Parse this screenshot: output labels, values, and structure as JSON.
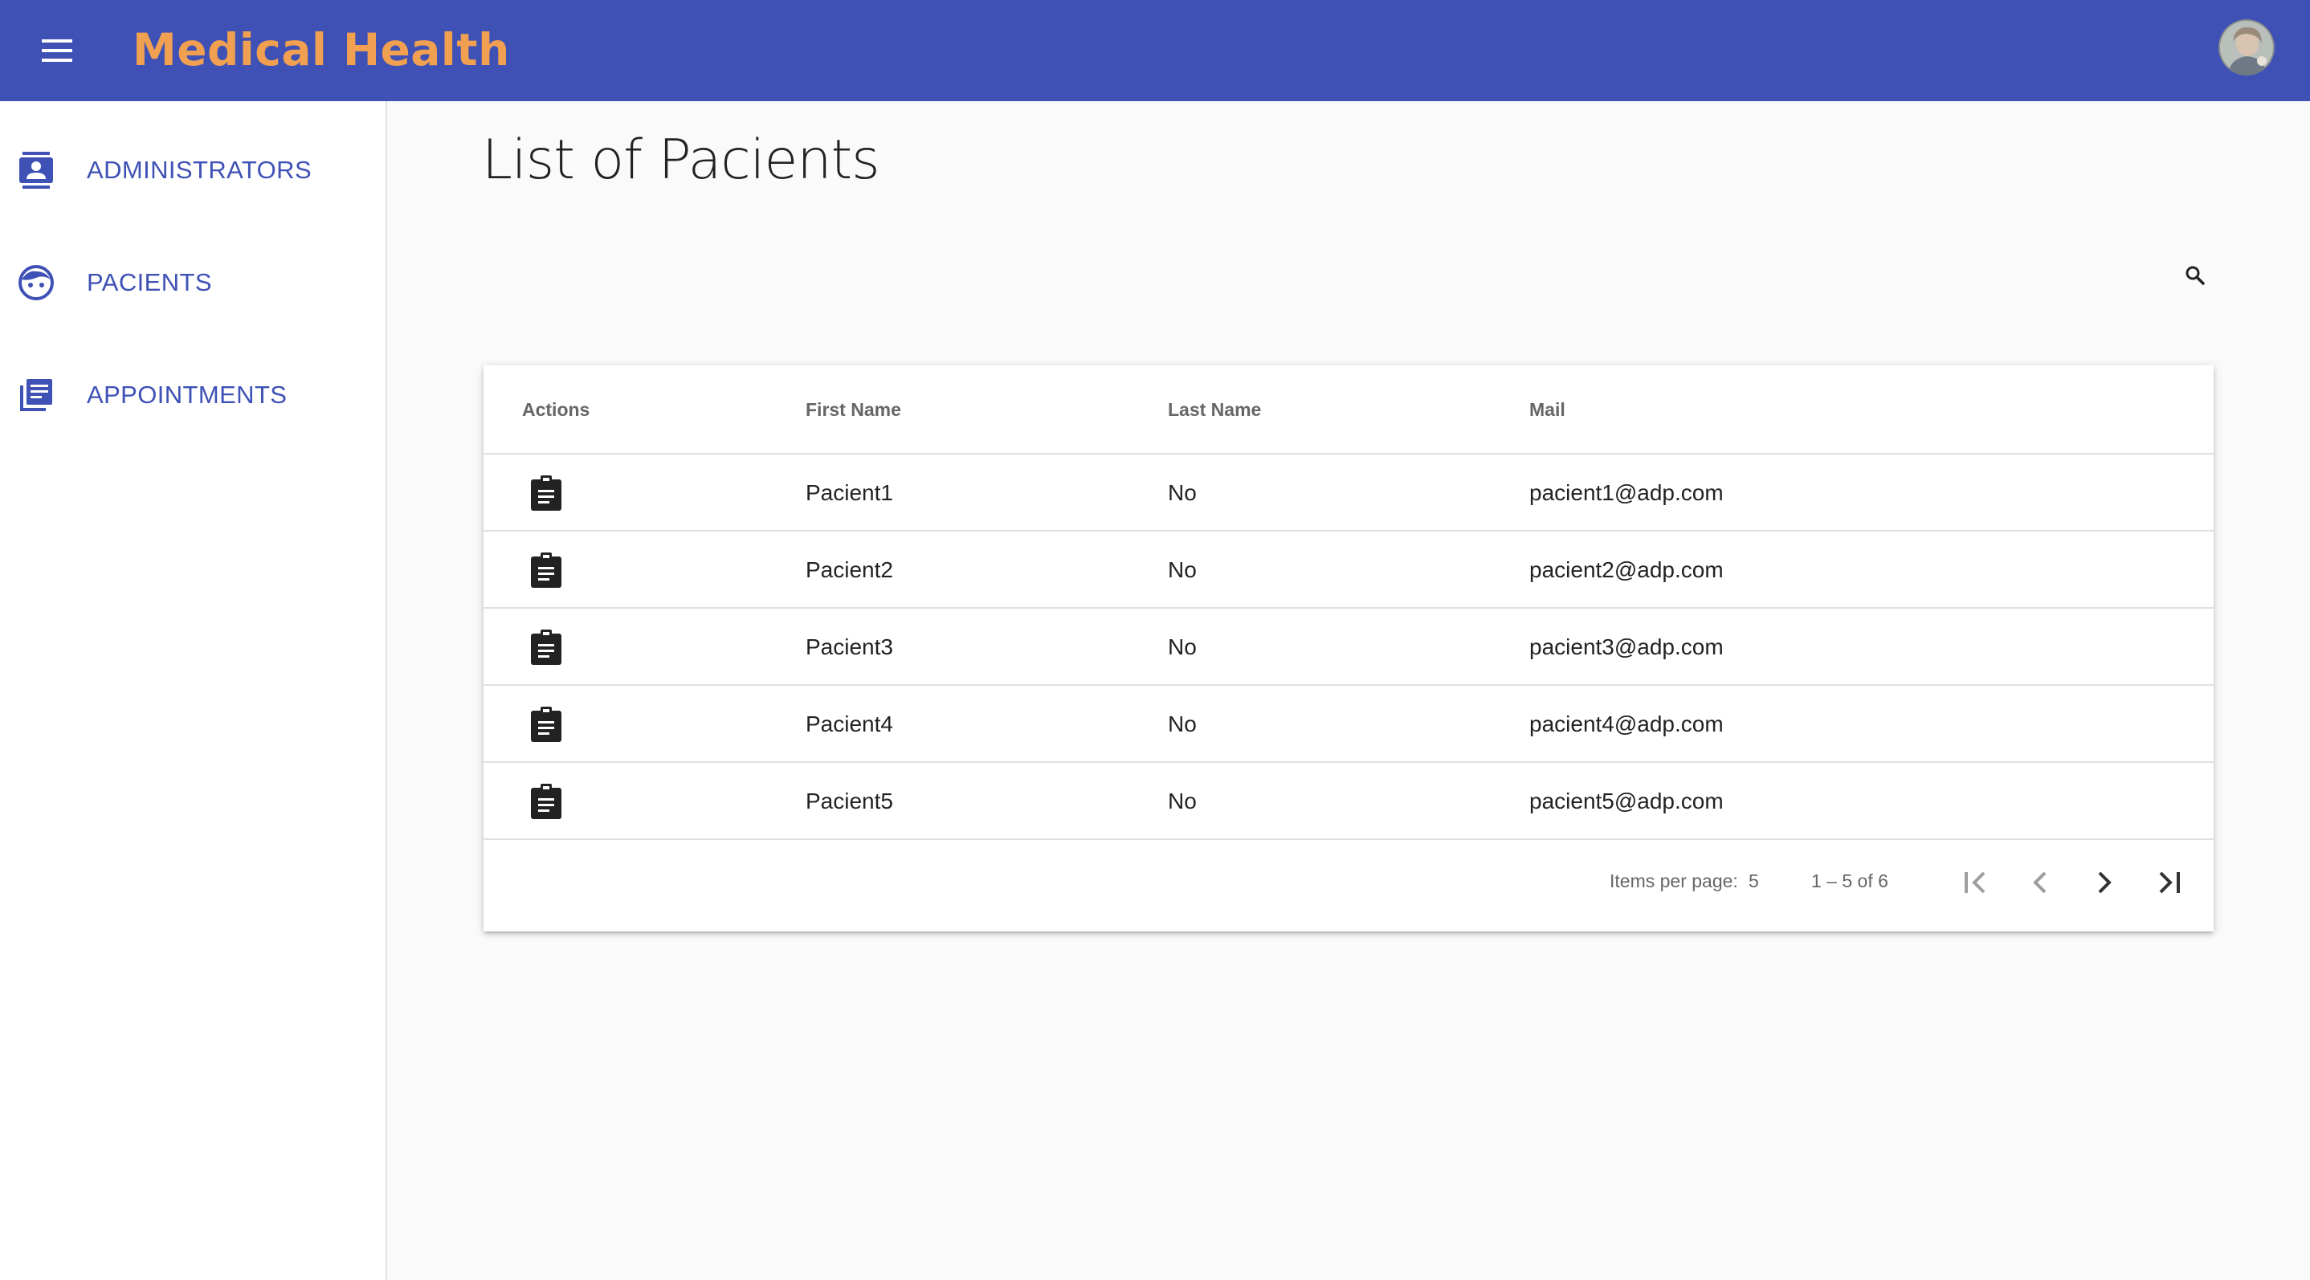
{
  "header": {
    "title": "Medical Health",
    "menu_icon": "menu-icon",
    "avatar_icon": "user-avatar",
    "background_color": "#3f51b5",
    "title_color": "#f0a050"
  },
  "sidebar": {
    "items": [
      {
        "label": "ADMINISTRATORS",
        "icon": "contact-card-icon"
      },
      {
        "label": "PACIENTS",
        "icon": "face-icon"
      },
      {
        "label": "APPOINTMENTS",
        "icon": "library-books-icon"
      }
    ],
    "accent_color": "#3f51b5"
  },
  "main": {
    "title": "List of Pacients",
    "search_icon": "search-icon",
    "table": {
      "columns": [
        "Actions",
        "First Name",
        "Last Name",
        "Mail"
      ],
      "rows": [
        {
          "first_name": "Pacient1",
          "last_name": "No",
          "mail": "pacient1@adp.com",
          "action_icon": "clipboard-icon"
        },
        {
          "first_name": "Pacient2",
          "last_name": "No",
          "mail": "pacient2@adp.com",
          "action_icon": "clipboard-icon"
        },
        {
          "first_name": "Pacient3",
          "last_name": "No",
          "mail": "pacient3@adp.com",
          "action_icon": "clipboard-icon"
        },
        {
          "first_name": "Pacient4",
          "last_name": "No",
          "mail": "pacient4@adp.com",
          "action_icon": "clipboard-icon"
        },
        {
          "first_name": "Pacient5",
          "last_name": "No",
          "mail": "pacient5@adp.com",
          "action_icon": "clipboard-icon"
        }
      ]
    },
    "paginator": {
      "items_per_page_label": "Items per page:",
      "items_per_page_value": "5",
      "range_label": "1 – 5 of 6",
      "first_page_icon": "first-page-icon",
      "previous_page_icon": "chevron-left-icon",
      "next_page_icon": "chevron-right-icon",
      "last_page_icon": "last-page-icon"
    }
  }
}
